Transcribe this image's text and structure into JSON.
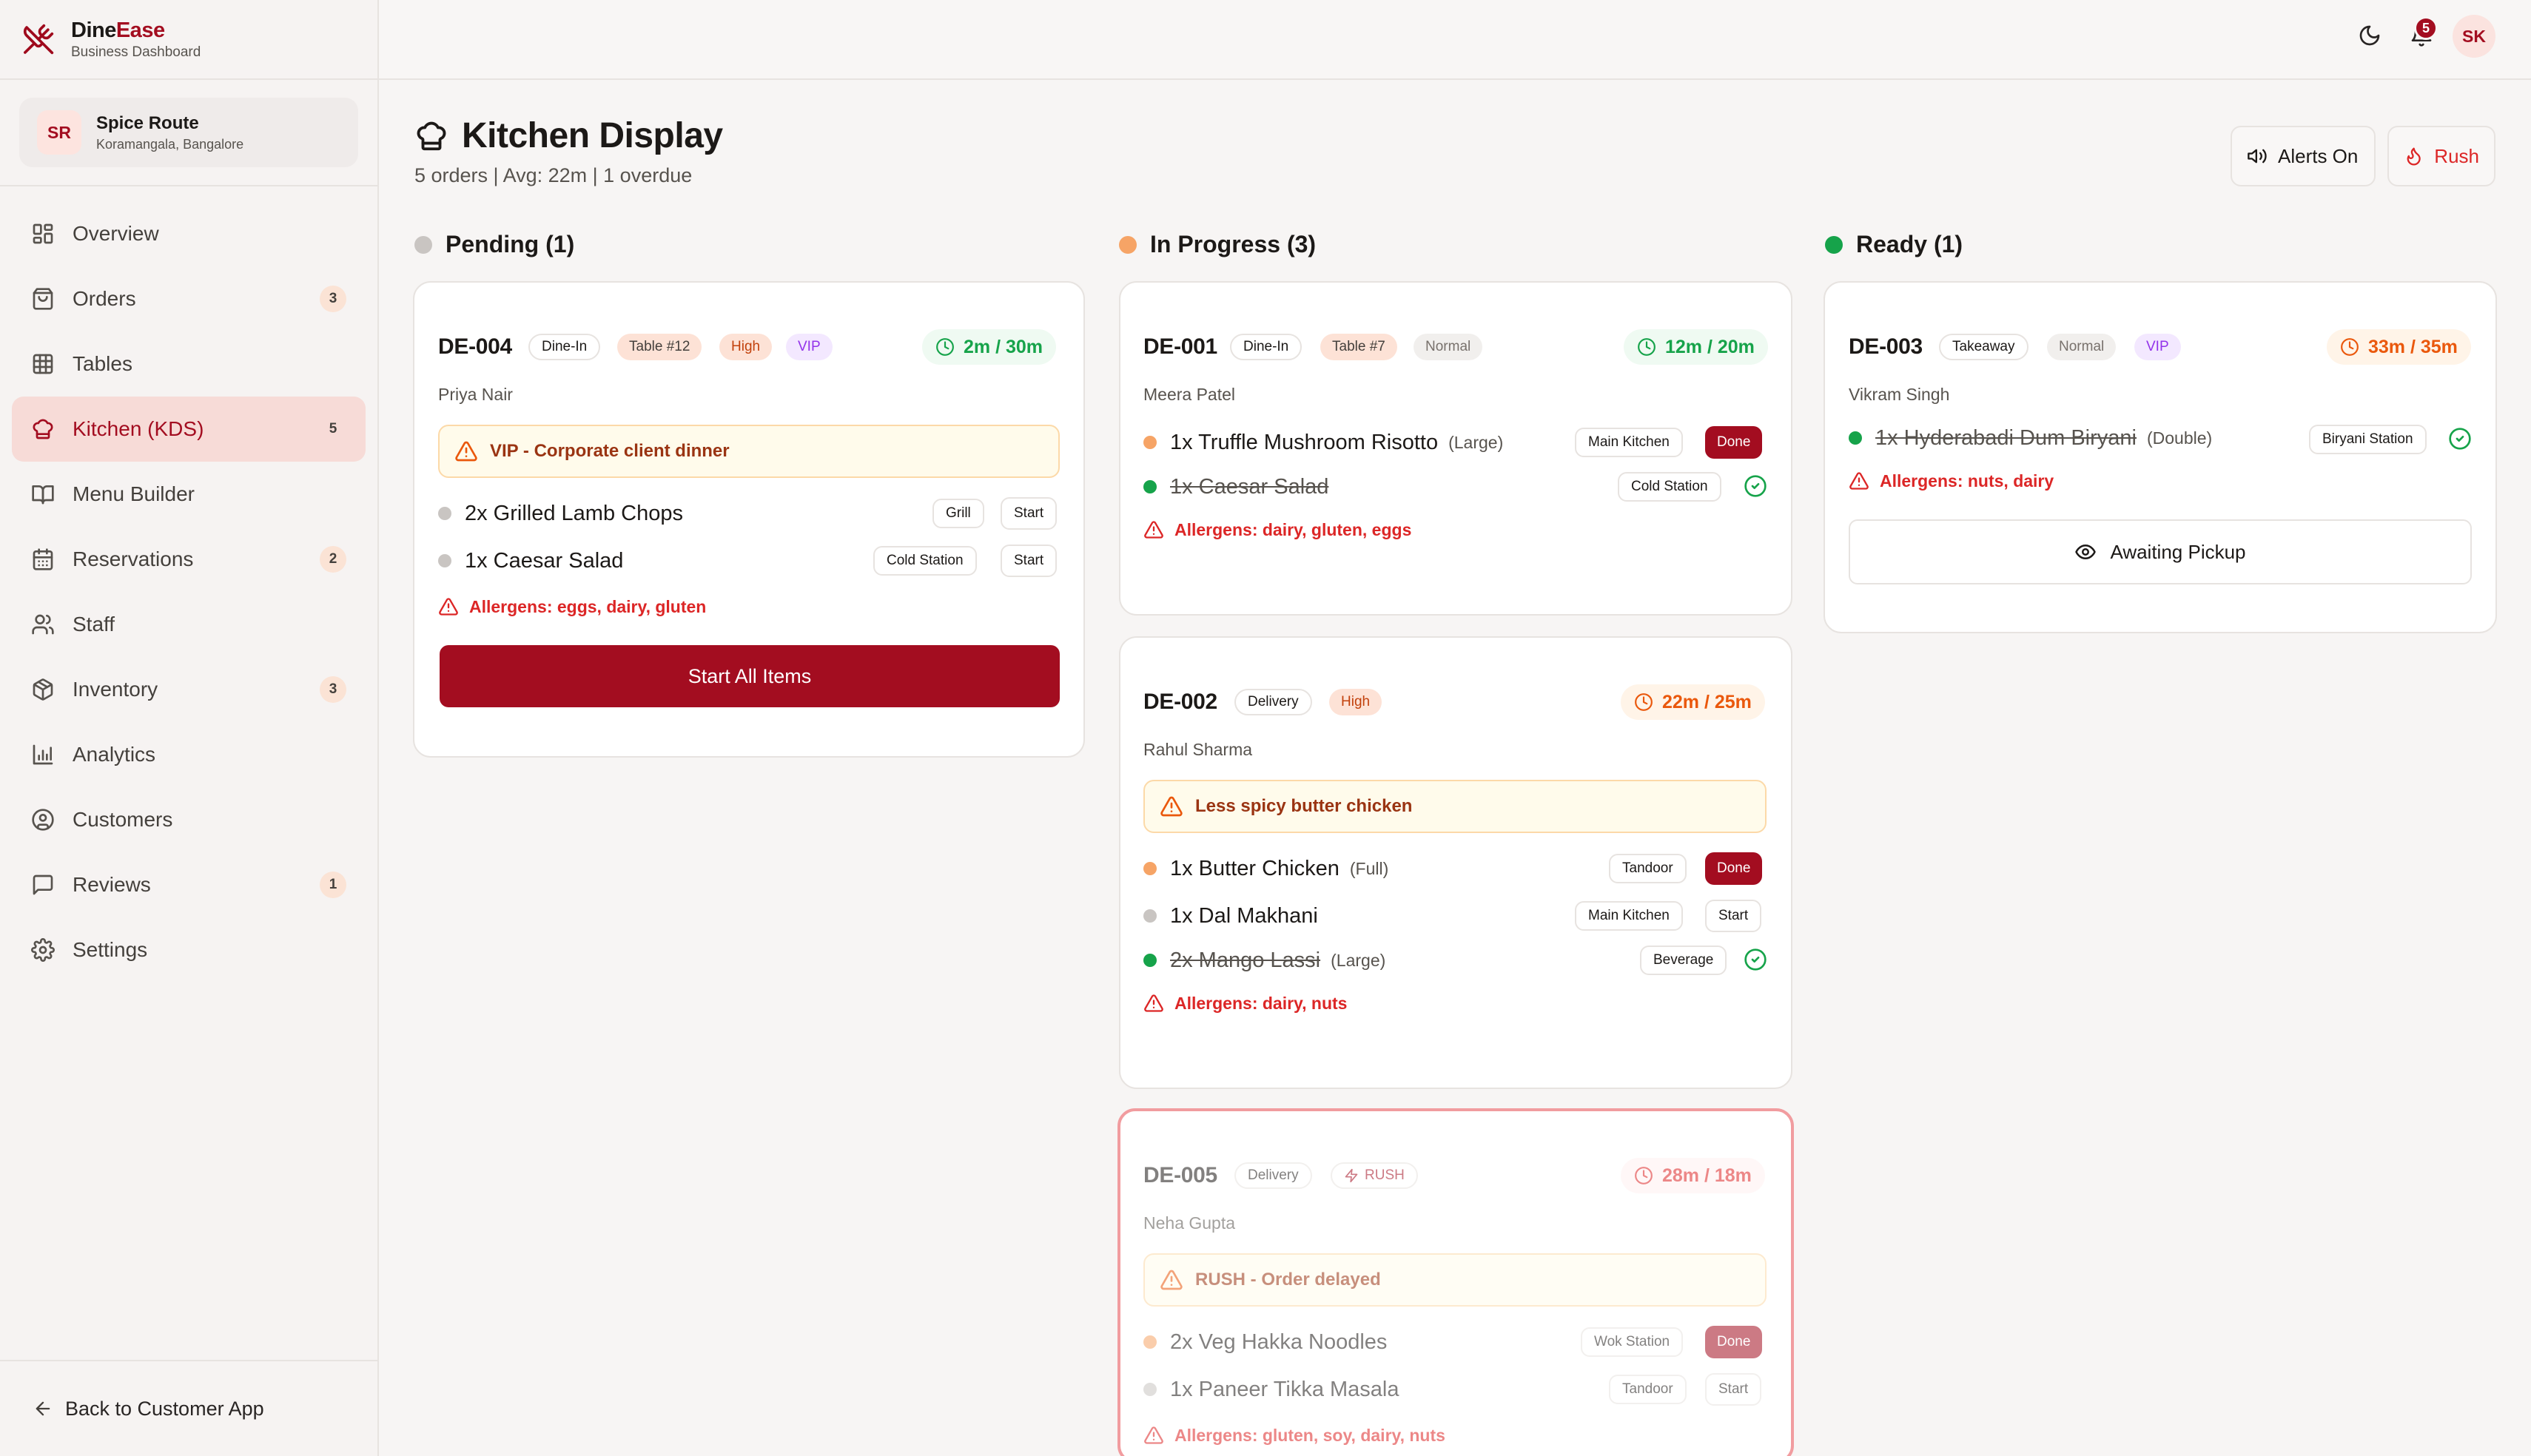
{
  "brand": {
    "name_part1": "Dine",
    "name_part2": "Ease",
    "subtitle": "Business Dashboard"
  },
  "restaurant": {
    "initials": "SR",
    "name": "Spice Route",
    "location": "Koramangala, Bangalore"
  },
  "nav": [
    {
      "label": "Overview",
      "icon": "grid-icon"
    },
    {
      "label": "Orders",
      "icon": "clipboard-icon",
      "badge": "3"
    },
    {
      "label": "Tables",
      "icon": "table-icon"
    },
    {
      "label": "Kitchen (KDS)",
      "icon": "chef-hat-icon",
      "badge": "5",
      "active": true
    },
    {
      "label": "Menu Builder",
      "icon": "book-open-icon"
    },
    {
      "label": "Reservations",
      "icon": "calendar-icon",
      "badge": "2"
    },
    {
      "label": "Staff",
      "icon": "users-icon"
    },
    {
      "label": "Inventory",
      "icon": "package-icon",
      "badge": "3"
    },
    {
      "label": "Analytics",
      "icon": "bar-chart-icon"
    },
    {
      "label": "Customers",
      "icon": "user-circle-icon"
    },
    {
      "label": "Reviews",
      "icon": "message-icon",
      "badge": "1"
    },
    {
      "label": "Settings",
      "icon": "gear-icon"
    }
  ],
  "back_link": "Back to Customer App",
  "topbar": {
    "notification_count": "5",
    "user_initials": "SK"
  },
  "header": {
    "title": "Kitchen Display",
    "subtitle": "5 orders | Avg: 22m | 1 overdue",
    "alerts_label": "Alerts On",
    "rush_label": "Rush"
  },
  "columns": {
    "pending": "Pending (1)",
    "in_progress": "In Progress (3)",
    "ready": "Ready (1)"
  },
  "colors": {
    "brand": "#a30d20",
    "pending": "#c4c1bf",
    "in_progress": "#f6a466",
    "ready": "#16a34a"
  },
  "orders": {
    "de004": {
      "id": "DE-004",
      "tags": [
        "Dine-In",
        "Table #12",
        "High",
        "VIP"
      ],
      "timer": "2m / 30m",
      "customer": "Priya Nair",
      "note": "VIP - Corporate client dinner",
      "items": [
        {
          "name": "2x Grilled Lamb Chops",
          "station": "Grill",
          "action": "Start"
        },
        {
          "name": "1x Caesar Salad",
          "station": "Cold Station",
          "action": "Start"
        }
      ],
      "allergens": "Allergens: eggs, dairy, gluten",
      "primary_action": "Start All Items"
    },
    "de001": {
      "id": "DE-001",
      "tags": [
        "Dine-In",
        "Table #7",
        "Normal"
      ],
      "timer": "12m / 20m",
      "customer": "Meera Patel",
      "items": [
        {
          "name": "1x Truffle Mushroom Risotto",
          "size": "(Large)",
          "station": "Main Kitchen",
          "action": "Done"
        },
        {
          "name": "1x Caesar Salad",
          "station": "Cold Station"
        }
      ],
      "allergens": "Allergens: dairy, gluten, eggs"
    },
    "de002": {
      "id": "DE-002",
      "tags": [
        "Delivery",
        "High"
      ],
      "timer": "22m / 25m",
      "customer": "Rahul Sharma",
      "note": "Less spicy butter chicken",
      "items": [
        {
          "name": "1x Butter Chicken",
          "size": "(Full)",
          "station": "Tandoor",
          "action": "Done"
        },
        {
          "name": "1x Dal Makhani",
          "station": "Main Kitchen",
          "action": "Start"
        },
        {
          "name": "2x Mango Lassi",
          "size": "(Large)",
          "station": "Beverage"
        }
      ],
      "allergens": "Allergens: dairy, nuts"
    },
    "de005": {
      "id": "DE-005",
      "tags": [
        "Delivery",
        "RUSH"
      ],
      "timer": "28m / 18m",
      "customer": "Neha Gupta",
      "note": "RUSH - Order delayed",
      "items": [
        {
          "name": "2x Veg Hakka Noodles",
          "station": "Wok Station",
          "action": "Done"
        },
        {
          "name": "1x Paneer Tikka Masala",
          "station": "Tandoor",
          "action": "Start"
        }
      ],
      "allergens": "Allergens: gluten, soy, dairy, nuts"
    },
    "de003": {
      "id": "DE-003",
      "tags": [
        "Takeaway",
        "Normal",
        "VIP"
      ],
      "timer": "33m / 35m",
      "customer": "Vikram Singh",
      "items": [
        {
          "name": "1x Hyderabadi Dum Biryani",
          "size": "(Double)",
          "station": "Biryani Station"
        }
      ],
      "allergens": "Allergens: nuts, dairy",
      "primary_action": "Awaiting Pickup"
    }
  }
}
